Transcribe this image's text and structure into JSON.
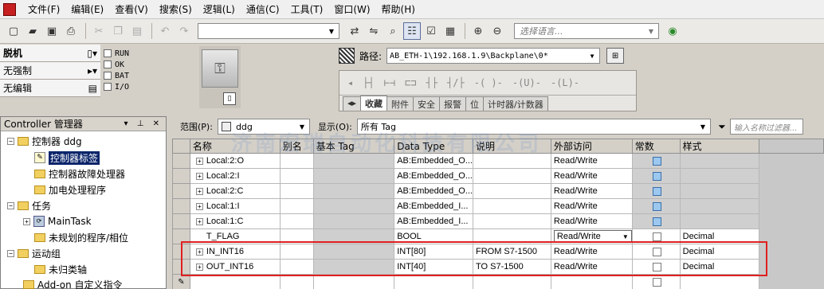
{
  "menu": [
    "文件(F)",
    "编辑(E)",
    "查看(V)",
    "搜索(S)",
    "逻辑(L)",
    "通信(C)",
    "工具(T)",
    "窗口(W)",
    "帮助(H)"
  ],
  "toolbar": {
    "language_placeholder": "选择语言..."
  },
  "status": {
    "mode": "脱机",
    "forces": "无强制",
    "edits": "无编辑",
    "flags": [
      "RUN",
      "OK",
      "BAT",
      "I/O"
    ]
  },
  "path": {
    "label": "路径:",
    "value": "AB_ETH-1\\192.168.1.9\\Backplane\\0*"
  },
  "palette": {
    "tabs": [
      "收藏",
      "附件",
      "安全",
      "报警",
      "位",
      "计时器/计数器"
    ]
  },
  "left_pane": {
    "title": "Controller 管理器",
    "tree": [
      {
        "label": "控制器 ddg"
      },
      {
        "label": "控制器标签"
      },
      {
        "label": "控制器故障处理器"
      },
      {
        "label": "加电处理程序"
      },
      {
        "label": "任务"
      },
      {
        "label": "MainTask"
      },
      {
        "label": "未规划的程序/相位"
      },
      {
        "label": "运动组"
      },
      {
        "label": "未归类轴"
      },
      {
        "label": "Add-on 自定义指令"
      }
    ]
  },
  "scope": {
    "label": "范围(P):",
    "value": "ddg",
    "show_label": "显示(O):",
    "show_value": "所有 Tag",
    "filter_placeholder": "输入名称过滤器..."
  },
  "grid": {
    "headers": [
      "名称",
      "别名",
      "基本 Tag",
      "Data Type",
      "说明",
      "外部访问",
      "常数",
      "样式"
    ],
    "rows": [
      {
        "name": "Local:2:O",
        "type": "AB:Embedded_O...",
        "desc": "",
        "access": "Read/Write",
        "style": ""
      },
      {
        "name": "Local:2:I",
        "type": "AB:Embedded_O...",
        "desc": "",
        "access": "Read/Write",
        "style": ""
      },
      {
        "name": "Local:2:C",
        "type": "AB:Embedded_O...",
        "desc": "",
        "access": "Read/Write",
        "style": ""
      },
      {
        "name": "Local:1:I",
        "type": "AB:Embedded_I...",
        "desc": "",
        "access": "Read/Write",
        "style": ""
      },
      {
        "name": "Local:1:C",
        "type": "AB:Embedded_I...",
        "desc": "",
        "access": "Read/Write",
        "style": ""
      },
      {
        "name": "T_FLAG",
        "type": "BOOL",
        "desc": "",
        "access": "Read/Write",
        "style": "Decimal"
      },
      {
        "name": "IN_INT16",
        "type": "INT[80]",
        "desc": "FROM S7-1500",
        "access": "Read/Write",
        "style": "Decimal"
      },
      {
        "name": "OUT_INT16",
        "type": "INT[40]",
        "desc": "TO S7-1500",
        "access": "Read/Write",
        "style": "Decimal"
      }
    ]
  },
  "watermark": "济南宏瑞自动化科技有限公司",
  "colors": {
    "highlight": "#e02020",
    "selection": "#0a246a"
  }
}
